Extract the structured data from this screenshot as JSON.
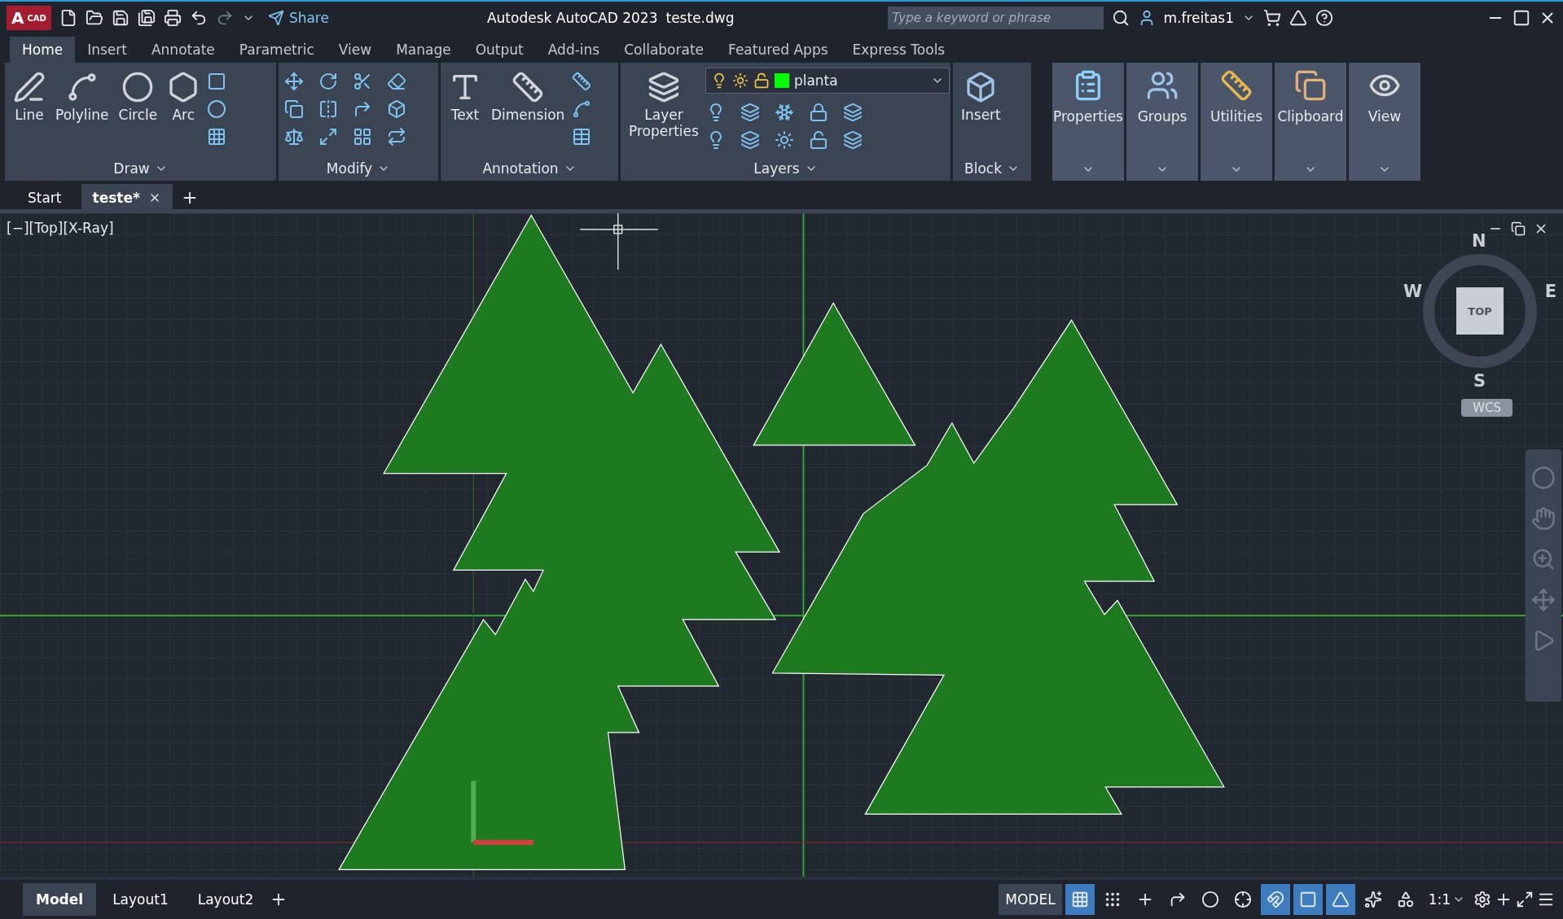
{
  "title_bar": {
    "logo_letter": "A",
    "logo_text": "CAD",
    "share": "Share",
    "title": "Autodesk AutoCAD 2023",
    "file": "teste.dwg",
    "search": {
      "placeholder": "Type a keyword or phrase"
    },
    "user": "m.freitas1"
  },
  "ribbon_tabs": [
    {
      "label": "Home",
      "selected": true
    },
    {
      "label": "Insert",
      "selected": false
    },
    {
      "label": "Annotate",
      "selected": false
    },
    {
      "label": "Parametric",
      "selected": false
    },
    {
      "label": "View",
      "selected": false
    },
    {
      "label": "Manage",
      "selected": false
    },
    {
      "label": "Output",
      "selected": false
    },
    {
      "label": "Add-ins",
      "selected": false
    },
    {
      "label": "Collaborate",
      "selected": false
    },
    {
      "label": "Featured Apps",
      "selected": false
    },
    {
      "label": "Express Tools",
      "selected": false
    }
  ],
  "draw_panel": {
    "title": "Draw",
    "tools": [
      "Line",
      "Polyline",
      "Circle",
      "Arc"
    ]
  },
  "modify_panel": {
    "title": "Modify"
  },
  "annotation_panel": {
    "title": "Annotation",
    "tools": [
      "Text",
      "Dimension"
    ]
  },
  "layers_panel": {
    "title": "Layers",
    "tool": "Layer Properties",
    "layer": {
      "name": "planta",
      "color": "#00ff00"
    }
  },
  "block_panel": {
    "title": "Block",
    "tool": "Insert"
  },
  "big_panels": [
    "Properties",
    "Groups",
    "Utilities",
    "Clipboard",
    "View"
  ],
  "file_tabs": [
    {
      "label": "Start",
      "selected": false
    },
    {
      "label": "teste*",
      "selected": true
    }
  ],
  "viewport": {
    "label": "[−][Top][X-Ray]",
    "compass": {
      "north": "N",
      "west": "W",
      "east": "E",
      "south": "S",
      "face": "TOP",
      "ucs": "WCS"
    }
  },
  "layout_tabs": [
    {
      "label": "Model",
      "selected": true
    },
    {
      "label": "Layout1",
      "selected": false
    },
    {
      "label": "Layout2",
      "selected": false
    }
  ],
  "status_bar": {
    "mode": "MODEL",
    "scale": "1:1",
    "toggles": [
      {
        "on": true
      },
      {
        "on": false
      },
      {
        "on": false
      },
      {
        "on": false
      },
      {
        "on": false
      },
      {
        "on": false
      },
      {
        "on": true
      },
      {
        "on": true
      },
      {
        "on": true
      },
      {
        "on": false
      },
      {
        "on": false
      }
    ]
  }
}
